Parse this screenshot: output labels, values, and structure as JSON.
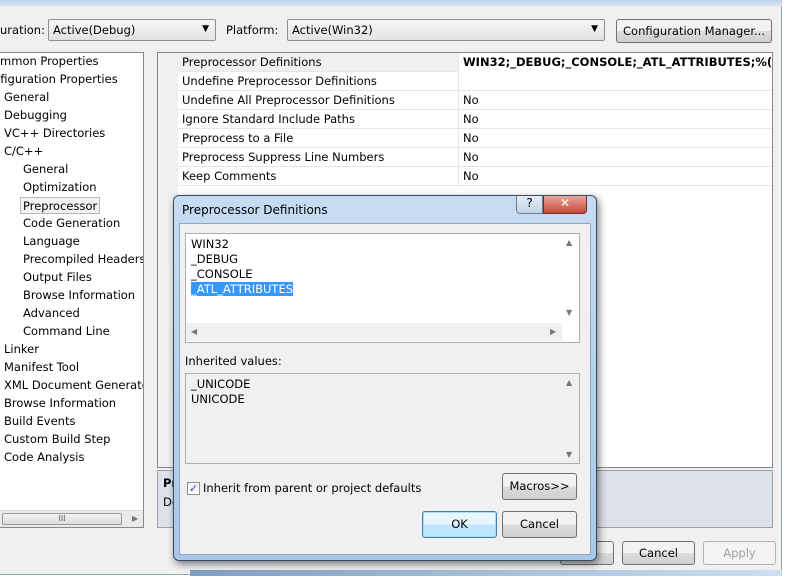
{
  "toolbar": {
    "configuration_label": "uration:",
    "configuration_value": "Active(Debug)",
    "platform_label": "Platform:",
    "platform_value": "Active(Win32)",
    "config_manager": "Configuration Manager..."
  },
  "tree": {
    "items": [
      {
        "label": "ommon Properties",
        "level": 0
      },
      {
        "label": "nfiguration Properties",
        "level": 0
      },
      {
        "label": "General",
        "level": 1
      },
      {
        "label": "Debugging",
        "level": 1
      },
      {
        "label": "VC++ Directories",
        "level": 1
      },
      {
        "label": "C/C++",
        "level": 1
      },
      {
        "label": "General",
        "level": 2
      },
      {
        "label": "Optimization",
        "level": 2
      },
      {
        "label": "Preprocessor",
        "level": 2,
        "selected": true
      },
      {
        "label": "Code Generation",
        "level": 2
      },
      {
        "label": "Language",
        "level": 2
      },
      {
        "label": "Precompiled Headers",
        "level": 2
      },
      {
        "label": "Output Files",
        "level": 2
      },
      {
        "label": "Browse Information",
        "level": 2
      },
      {
        "label": "Advanced",
        "level": 2
      },
      {
        "label": "Command Line",
        "level": 2
      },
      {
        "label": "Linker",
        "level": 1
      },
      {
        "label": "Manifest Tool",
        "level": 1
      },
      {
        "label": "XML Document Generator",
        "level": 1
      },
      {
        "label": "Browse Information",
        "level": 1
      },
      {
        "label": "Build Events",
        "level": 1
      },
      {
        "label": "Custom Build Step",
        "level": 1
      },
      {
        "label": "Code Analysis",
        "level": 1
      }
    ],
    "scroll_thumb": "III"
  },
  "grid": {
    "rows": [
      {
        "name": "Preprocessor Definitions",
        "value": "WIN32;_DEBUG;_CONSOLE;_ATL_ATTRIBUTES;%(Preproc"
      },
      {
        "name": "Undefine Preprocessor Definitions",
        "value": ""
      },
      {
        "name": "Undefine All Preprocessor Definitions",
        "value": "No"
      },
      {
        "name": "Ignore Standard Include Paths",
        "value": "No"
      },
      {
        "name": "Preprocess to a File",
        "value": "No"
      },
      {
        "name": "Preprocess Suppress Line Numbers",
        "value": "No"
      },
      {
        "name": "Keep Comments",
        "value": "No"
      }
    ]
  },
  "description": {
    "title": "Pr",
    "text": "De"
  },
  "footer": {
    "ok": "OK",
    "cancel": "Cancel",
    "apply": "Apply"
  },
  "dialog": {
    "title": "Preprocessor Definitions",
    "help": "?",
    "close": "✕",
    "definitions": [
      "WIN32",
      "_DEBUG",
      "_CONSOLE",
      "_ATL_ATTRIBUTES"
    ],
    "inherited_label": "Inherited values:",
    "inherited": [
      "_UNICODE",
      "UNICODE"
    ],
    "inherit_checkbox": "Inherit from parent or project defaults",
    "inherit_checked": true,
    "macros": "Macros>>",
    "ok": "OK",
    "cancel": "Cancel"
  }
}
